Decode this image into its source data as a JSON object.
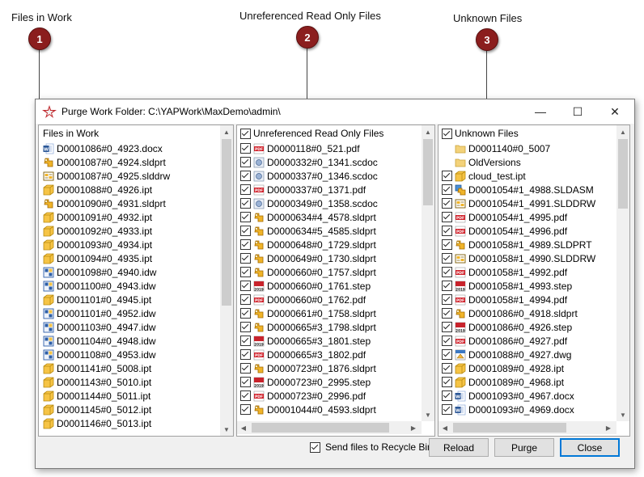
{
  "callouts": [
    {
      "title": "Files in Work",
      "number": "1"
    },
    {
      "title": "Unreferenced Read Only Files",
      "number": "2"
    },
    {
      "title": "Unknown Files",
      "number": "3"
    }
  ],
  "window": {
    "title": "Purge Work Folder: C:\\YAPWork\\MaxDemo\\admin\\",
    "minimize": "—",
    "maximize": "☐",
    "close": "✕"
  },
  "panel1": {
    "header": "Files in Work",
    "items": [
      {
        "name": "D0001086#0_4923.docx",
        "icon": "word-icon"
      },
      {
        "name": "D0001087#0_4924.sldprt",
        "icon": "sldprt-icon"
      },
      {
        "name": "D0001087#0_4925.slddrw",
        "icon": "slddrw-icon"
      },
      {
        "name": "D0001088#0_4926.ipt",
        "icon": "ipt-icon"
      },
      {
        "name": "D0001090#0_4931.sldprt",
        "icon": "sldprt-icon"
      },
      {
        "name": "D0001091#0_4932.ipt",
        "icon": "ipt-icon"
      },
      {
        "name": "D0001092#0_4933.ipt",
        "icon": "ipt-icon"
      },
      {
        "name": "D0001093#0_4934.ipt",
        "icon": "ipt-icon"
      },
      {
        "name": "D0001094#0_4935.ipt",
        "icon": "ipt-icon"
      },
      {
        "name": "D0001098#0_4940.idw",
        "icon": "idw-icon"
      },
      {
        "name": "D0001100#0_4943.idw",
        "icon": "idw-icon"
      },
      {
        "name": "D0001101#0_4945.ipt",
        "icon": "ipt-icon"
      },
      {
        "name": "D0001101#0_4952.idw",
        "icon": "idw-icon"
      },
      {
        "name": "D0001103#0_4947.idw",
        "icon": "idw-icon"
      },
      {
        "name": "D0001104#0_4948.idw",
        "icon": "idw-icon"
      },
      {
        "name": "D0001108#0_4953.idw",
        "icon": "idw-icon"
      },
      {
        "name": "D0001141#0_5008.ipt",
        "icon": "ipt-icon"
      },
      {
        "name": "D0001143#0_5010.ipt",
        "icon": "ipt-icon"
      },
      {
        "name": "D0001144#0_5011.ipt",
        "icon": "ipt-icon"
      },
      {
        "name": "D0001145#0_5012.ipt",
        "icon": "ipt-icon"
      },
      {
        "name": "D0001146#0_5013.ipt",
        "icon": "ipt-icon"
      }
    ],
    "scroll_fraction": 0.0
  },
  "panel2": {
    "header": "Unreferenced Read Only Files",
    "items": [
      {
        "name": "D0000118#0_521.pdf",
        "icon": "pdf-icon"
      },
      {
        "name": "D0000332#0_1341.scdoc",
        "icon": "scdoc-icon"
      },
      {
        "name": "D0000337#0_1346.scdoc",
        "icon": "scdoc-icon"
      },
      {
        "name": "D0000337#0_1371.pdf",
        "icon": "pdf-icon"
      },
      {
        "name": "D0000349#0_1358.scdoc",
        "icon": "scdoc-icon"
      },
      {
        "name": "D0000634#4_4578.sldprt",
        "icon": "sldprt-icon"
      },
      {
        "name": "D0000634#5_4585.sldprt",
        "icon": "sldprt-icon"
      },
      {
        "name": "D0000648#0_1729.sldprt",
        "icon": "sldprt-icon"
      },
      {
        "name": "D0000649#0_1730.sldprt",
        "icon": "sldprt-icon"
      },
      {
        "name": "D0000660#0_1757.sldprt",
        "icon": "sldprt-icon"
      },
      {
        "name": "D0000660#0_1761.step",
        "icon": "step-icon"
      },
      {
        "name": "D0000660#0_1762.pdf",
        "icon": "pdf-icon"
      },
      {
        "name": "D0000661#0_1758.sldprt",
        "icon": "sldprt-icon"
      },
      {
        "name": "D0000665#3_1798.sldprt",
        "icon": "sldprt-icon"
      },
      {
        "name": "D0000665#3_1801.step",
        "icon": "step-icon"
      },
      {
        "name": "D0000665#3_1802.pdf",
        "icon": "pdf-icon"
      },
      {
        "name": "D0000723#0_1876.sldprt",
        "icon": "sldprt-icon"
      },
      {
        "name": "D0000723#0_2995.step",
        "icon": "step-icon"
      },
      {
        "name": "D0000723#0_2996.pdf",
        "icon": "pdf-icon"
      },
      {
        "name": "D0001044#0_4593.sldprt",
        "icon": "sldprt-icon"
      }
    ]
  },
  "panel3": {
    "header": "Unknown Files",
    "items": [
      {
        "name": "D0001140#0_5007",
        "icon": "folder-icon",
        "checkbox": false
      },
      {
        "name": "OldVersions",
        "icon": "folder-icon",
        "checkbox": false
      },
      {
        "name": "cloud_test.ipt",
        "icon": "ipt-icon",
        "checkbox": true
      },
      {
        "name": "D0001054#1_4988.SLDASM",
        "icon": "sldasm-icon",
        "checkbox": true
      },
      {
        "name": "D0001054#1_4991.SLDDRW",
        "icon": "slddrw-icon",
        "checkbox": true
      },
      {
        "name": "D0001054#1_4995.pdf",
        "icon": "pdf-icon",
        "checkbox": true
      },
      {
        "name": "D0001054#1_4996.pdf",
        "icon": "pdf-icon",
        "checkbox": true
      },
      {
        "name": "D0001058#1_4989.SLDPRT",
        "icon": "sldprt-icon",
        "checkbox": true
      },
      {
        "name": "D0001058#1_4990.SLDDRW",
        "icon": "slddrw-icon",
        "checkbox": true
      },
      {
        "name": "D0001058#1_4992.pdf",
        "icon": "pdf-icon",
        "checkbox": true
      },
      {
        "name": "D0001058#1_4993.step",
        "icon": "step-icon",
        "checkbox": true
      },
      {
        "name": "D0001058#1_4994.pdf",
        "icon": "pdf-icon",
        "checkbox": true
      },
      {
        "name": "D0001086#0_4918.sldprt",
        "icon": "sldprt-icon",
        "checkbox": true
      },
      {
        "name": "D0001086#0_4926.step",
        "icon": "step-icon",
        "checkbox": true
      },
      {
        "name": "D0001086#0_4927.pdf",
        "icon": "pdf-icon",
        "checkbox": true
      },
      {
        "name": "D0001088#0_4927.dwg",
        "icon": "dwg-icon",
        "checkbox": true
      },
      {
        "name": "D0001089#0_4928.ipt",
        "icon": "ipt-icon",
        "checkbox": true
      },
      {
        "name": "D0001089#0_4968.ipt",
        "icon": "ipt-icon",
        "checkbox": true
      },
      {
        "name": "D0001093#0_4967.docx",
        "icon": "word-icon",
        "checkbox": true
      },
      {
        "name": "D0001093#0_4969.docx",
        "icon": "word-icon",
        "checkbox": true
      }
    ]
  },
  "icon_badge_year": "2019",
  "footer": {
    "recycle_label": "Send files to Recycle Bin",
    "reload_label": "Reload",
    "purge_label": "Purge",
    "close_label": "Close"
  },
  "colors": {
    "badge": "#8b1e1e",
    "default_button_border": "#0078d7"
  }
}
